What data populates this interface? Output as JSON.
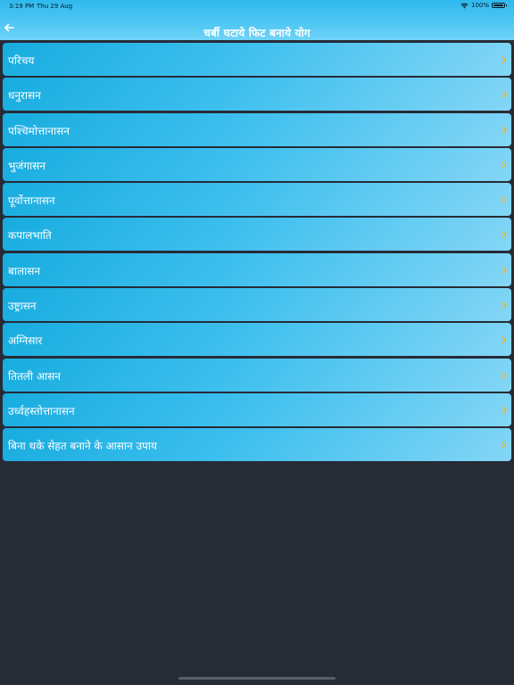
{
  "status_bar": {
    "time": "3:19 PM",
    "date": "Thu 29 Aug",
    "battery": "100%",
    "battery_level": 1.0
  },
  "header": {
    "title": "चर्बी घटाये फिट बनाये योग",
    "back_icon": "back-arrow-icon"
  },
  "list": {
    "items": [
      {
        "label": "परिचय"
      },
      {
        "label": "धनुरासन"
      },
      {
        "label": "पश्चिमोत्तानासन"
      },
      {
        "label": "भुजंगासन"
      },
      {
        "label": "पूर्वोत्तानासन"
      },
      {
        "label": "कपालभाति"
      },
      {
        "label": "बालासन"
      },
      {
        "label": "उष्ट्रासन"
      },
      {
        "label": "अग्निसार"
      },
      {
        "label": "तितली आसन"
      },
      {
        "label": "उर्ध्वहस्तोत्तानासन"
      },
      {
        "label": "बिना थके सेहत बनाने के आसान उपाय"
      }
    ],
    "chevron_icon": "chevron-right-icon"
  },
  "colors": {
    "background": "#272b36",
    "header": "#4dc6f3",
    "row_start": "#18acdf",
    "row_end": "#84d6f6",
    "chevron": "#f0b429"
  }
}
